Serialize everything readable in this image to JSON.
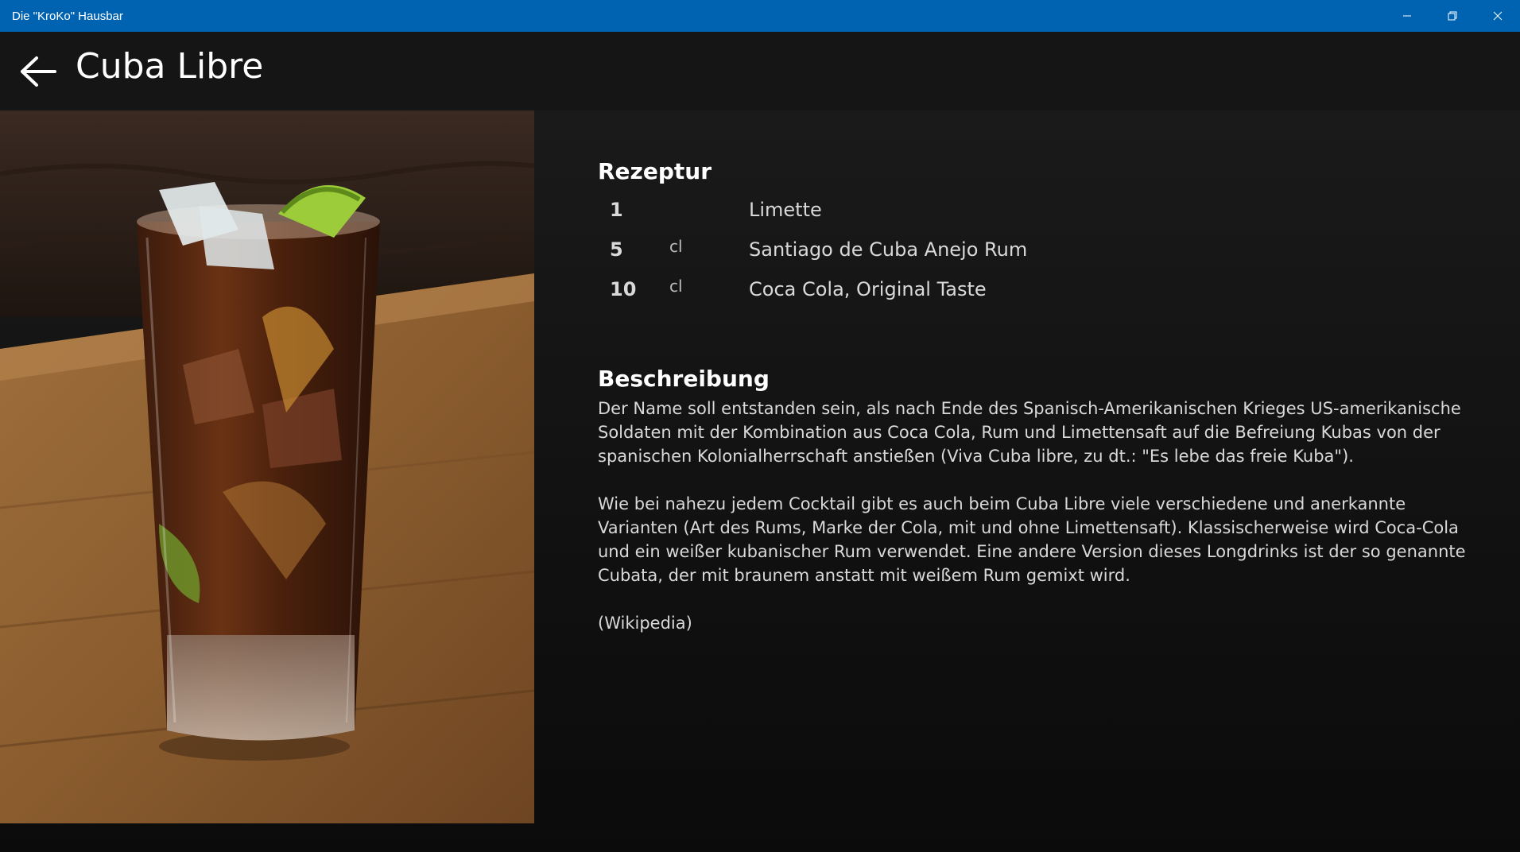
{
  "window": {
    "title": "Die \"KroKo\" Hausbar",
    "caption_icons": [
      "minimize-icon",
      "restore-icon",
      "close-icon"
    ]
  },
  "header": {
    "back_icon": "arrow-left-icon",
    "title": "Cuba Libre"
  },
  "photo": {
    "subject": "highball glass of cola with ice and lime wedges on a wooden table"
  },
  "recipe": {
    "heading": "Rezeptur",
    "ingredients": [
      {
        "qty": "1",
        "unit": "",
        "name": "Limette"
      },
      {
        "qty": "5",
        "unit": "cl",
        "name": "Santiago de Cuba Anejo Rum"
      },
      {
        "qty": "10",
        "unit": "cl",
        "name": "Coca Cola, Original Taste"
      }
    ]
  },
  "description": {
    "heading": "Beschreibung",
    "paragraphs": [
      "Der Name soll entstanden sein, als nach Ende des Spanisch-Amerikanischen Krieges US-amerikanische Soldaten mit der Kombination aus Coca Cola, Rum und Limettensaft auf die Befreiung Kubas von der spanischen Kolonialherrschaft anstießen (Viva Cuba libre, zu dt.: \"Es lebe das freie Kuba\").",
      "Wie bei nahezu jedem Cocktail gibt es auch beim Cuba Libre viele verschiedene und anerkannte Varianten (Art des Rums, Marke der Cola, mit und ohne Limettensaft). Klassischerweise wird Coca-Cola und ein weißer kubanischer Rum verwendet. Eine andere Version dieses Longdrinks ist der so genannte Cubata, der mit braunem anstatt mit weißem Rum gemixt wird."
    ],
    "source": "(Wikipedia)"
  },
  "colors": {
    "titlebar": "#0063b1",
    "background": "#101010",
    "text": "#d9d9d9"
  }
}
